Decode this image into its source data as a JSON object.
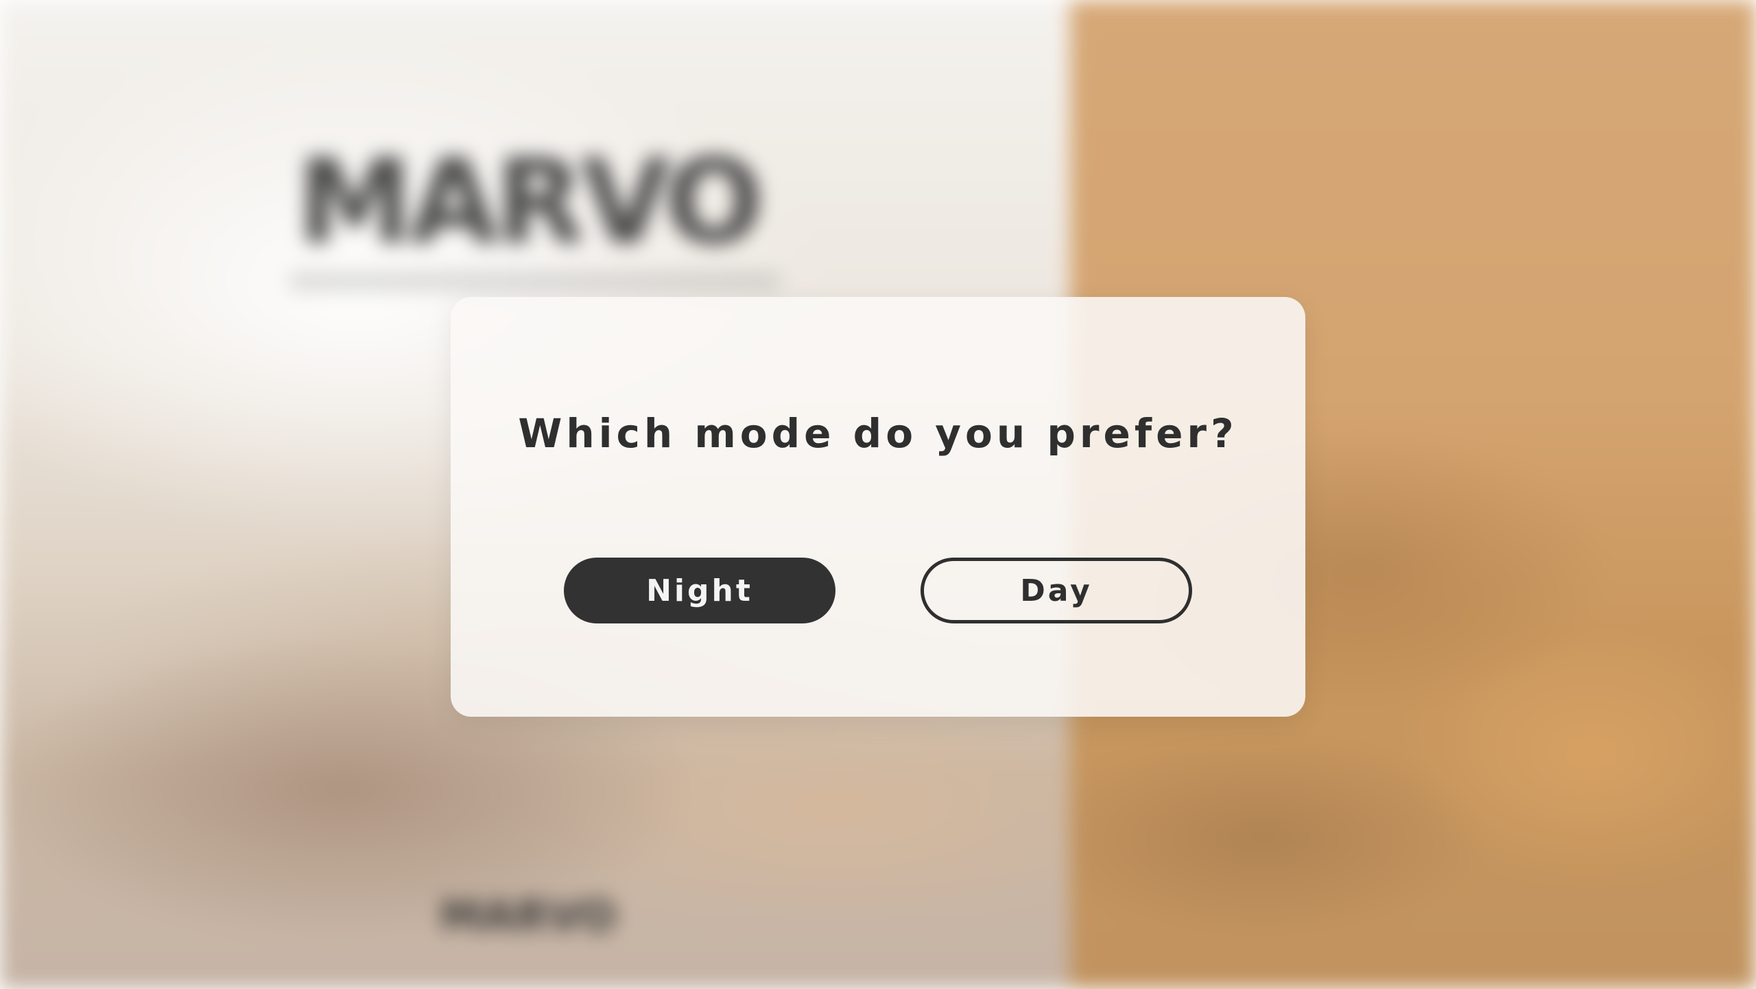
{
  "background": {
    "logo_text": "MARVO",
    "footer_text": "MARVO"
  },
  "modal": {
    "title": "Which mode do you prefer?",
    "buttons": [
      {
        "label": "Night"
      },
      {
        "label": "Day"
      }
    ]
  },
  "colors": {
    "night_button": "#323232",
    "accent_panel": "#d4a470"
  }
}
